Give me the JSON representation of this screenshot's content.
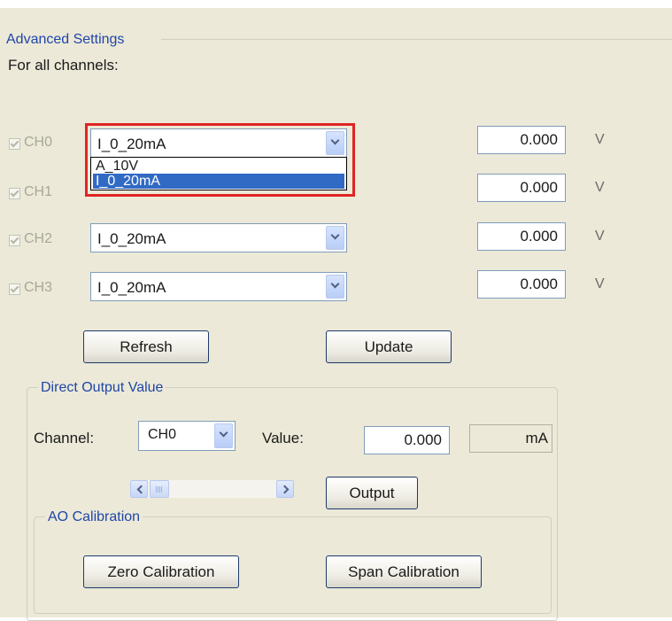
{
  "advanced": {
    "title": "Advanced Settings",
    "subtitle": "For all channels:",
    "unit_label": "V",
    "channels": [
      {
        "name": "CH0",
        "mode": "I_0_20mA",
        "value": "0.000"
      },
      {
        "name": "CH1",
        "mode": "I_0_20mA",
        "value": "0.000"
      },
      {
        "name": "CH2",
        "mode": "I_0_20mA",
        "value": "0.000"
      },
      {
        "name": "CH3",
        "mode": "I_0_20mA",
        "value": "0.000"
      }
    ],
    "dropdown_options": [
      {
        "label": "A_10V",
        "selected": false
      },
      {
        "label": "I_0_20mA",
        "selected": true
      }
    ],
    "refresh_button": "Refresh",
    "update_button": "Update"
  },
  "direct_output": {
    "title": "Direct Output Value",
    "channel_label": "Channel:",
    "channel_value": "CH0",
    "value_label": "Value:",
    "value": "0.000",
    "unit": "mA",
    "output_button": "Output"
  },
  "calibration": {
    "title": "AO Calibration",
    "zero_button": "Zero Calibration",
    "span_button": "Span Calibration"
  },
  "colors": {
    "panel": "#ece9d8",
    "group_title": "#1f46a8",
    "highlight": "#e02424",
    "selection": "#316ac5"
  }
}
